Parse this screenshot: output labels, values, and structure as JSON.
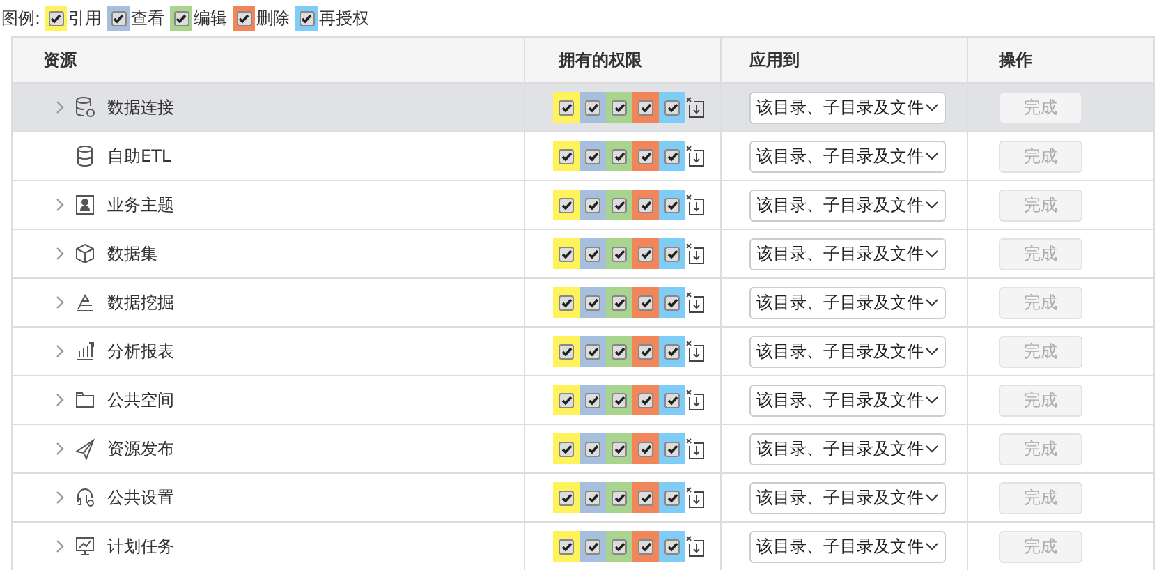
{
  "legend": {
    "label": "图例:",
    "items": [
      {
        "label": "引用",
        "color": "#fff35c",
        "checked": true
      },
      {
        "label": "查看",
        "color": "#a6bfdc",
        "checked": true
      },
      {
        "label": "编辑",
        "color": "#a8d48f",
        "checked": true
      },
      {
        "label": "删除",
        "color": "#f08659",
        "checked": true
      },
      {
        "label": "再授权",
        "color": "#7fcdf6",
        "checked": true
      }
    ]
  },
  "table": {
    "columns": [
      "资源",
      "拥有的权限",
      "应用到",
      "操作"
    ],
    "rows": [
      {
        "name": "数据连接",
        "expandable": true,
        "selected": true,
        "perms": [
          {
            "checked": true
          },
          {
            "checked": true
          },
          {
            "checked": true
          },
          {
            "checked": true
          },
          {
            "checked": true
          }
        ],
        "apply": "该目录、子目录及文件",
        "action": "完成",
        "disabled": true
      },
      {
        "name": "自助ETL",
        "expandable": false,
        "selected": false,
        "perms": [
          {
            "checked": true
          },
          {
            "checked": true
          },
          {
            "checked": true
          },
          {
            "checked": true
          },
          {
            "checked": true
          }
        ],
        "apply": "该目录、子目录及文件",
        "action": "完成",
        "disabled": true
      },
      {
        "name": "业务主题",
        "expandable": true,
        "selected": false,
        "perms": [
          {
            "checked": true
          },
          {
            "checked": true
          },
          {
            "checked": true
          },
          {
            "checked": true
          },
          {
            "checked": true
          }
        ],
        "apply": "该目录、子目录及文件",
        "action": "完成",
        "disabled": true
      },
      {
        "name": "数据集",
        "expandable": true,
        "selected": false,
        "perms": [
          {
            "checked": true
          },
          {
            "checked": true
          },
          {
            "checked": true
          },
          {
            "checked": true
          },
          {
            "checked": true
          }
        ],
        "apply": "该目录、子目录及文件",
        "action": "完成",
        "disabled": true
      },
      {
        "name": "数据挖掘",
        "expandable": true,
        "selected": false,
        "perms": [
          {
            "checked": true
          },
          {
            "checked": true
          },
          {
            "checked": true
          },
          {
            "checked": true
          },
          {
            "checked": true
          }
        ],
        "apply": "该目录、子目录及文件",
        "action": "完成",
        "disabled": true
      },
      {
        "name": "分析报表",
        "expandable": true,
        "selected": false,
        "perms": [
          {
            "checked": true
          },
          {
            "checked": true
          },
          {
            "checked": true
          },
          {
            "checked": true
          },
          {
            "checked": true
          }
        ],
        "apply": "该目录、子目录及文件",
        "action": "完成",
        "disabled": true
      },
      {
        "name": "公共空间",
        "expandable": true,
        "selected": false,
        "perms": [
          {
            "checked": true
          },
          {
            "checked": true
          },
          {
            "checked": true
          },
          {
            "checked": true
          },
          {
            "checked": true
          }
        ],
        "apply": "该目录、子目录及文件",
        "action": "完成",
        "disabled": true
      },
      {
        "name": "资源发布",
        "expandable": true,
        "selected": false,
        "perms": [
          {
            "checked": true
          },
          {
            "checked": true
          },
          {
            "checked": true
          },
          {
            "checked": true
          },
          {
            "checked": true
          }
        ],
        "apply": "该目录、子目录及文件",
        "action": "完成",
        "disabled": true
      },
      {
        "name": "公共设置",
        "expandable": true,
        "selected": false,
        "perms": [
          {
            "checked": true
          },
          {
            "checked": true
          },
          {
            "checked": true
          },
          {
            "checked": true
          },
          {
            "checked": true
          }
        ],
        "apply": "该目录、子目录及文件",
        "action": "完成",
        "disabled": true
      },
      {
        "name": "计划任务",
        "expandable": true,
        "selected": false,
        "perms": [
          {
            "checked": true
          },
          {
            "checked": true
          },
          {
            "checked": true
          },
          {
            "checked": true
          },
          {
            "checked": true
          }
        ],
        "apply": "该目录、子目录及文件",
        "action": "完成",
        "disabled": true
      }
    ]
  }
}
